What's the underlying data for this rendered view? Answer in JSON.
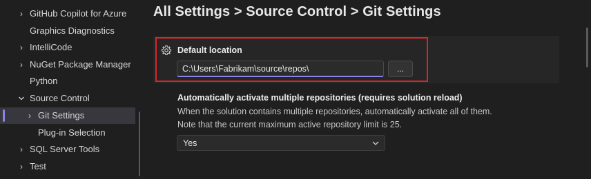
{
  "sidebar": {
    "items": [
      {
        "label": "GitHub Copilot for Azure",
        "chevron": true
      },
      {
        "label": "Graphics Diagnostics",
        "chevron": false
      },
      {
        "label": "IntelliCode",
        "chevron": true
      },
      {
        "label": "NuGet Package Manager",
        "chevron": true
      },
      {
        "label": "Python",
        "chevron": false
      },
      {
        "label": "Source Control",
        "chevron": true,
        "expanded": true
      },
      {
        "label": "Git Settings",
        "chevron": true,
        "selected": true
      },
      {
        "label": "Plug-in Selection",
        "chevron": false
      },
      {
        "label": "SQL Server Tools",
        "chevron": true
      },
      {
        "label": "Test",
        "chevron": true
      }
    ]
  },
  "main": {
    "breadcrumb_title": "All Settings > Source Control > Git Settings",
    "default_location": {
      "label": "Default location",
      "icon": "gear-icon",
      "value": "C:\\Users\\Fabrikam\\source\\repos\\",
      "browse_label": "..."
    },
    "multi_repo": {
      "label": "Automatically activate multiple repositories (requires solution reload)",
      "description_line1": "When the solution contains multiple repositories, automatically activate all of them.",
      "description_line2": "Note that the current maximum active repository limit is 25.",
      "selected": "Yes"
    }
  },
  "colors": {
    "background": "#1f1f1f",
    "accent": "#8a82e8",
    "highlight_border": "#d7262b",
    "selection": "#37373d"
  }
}
